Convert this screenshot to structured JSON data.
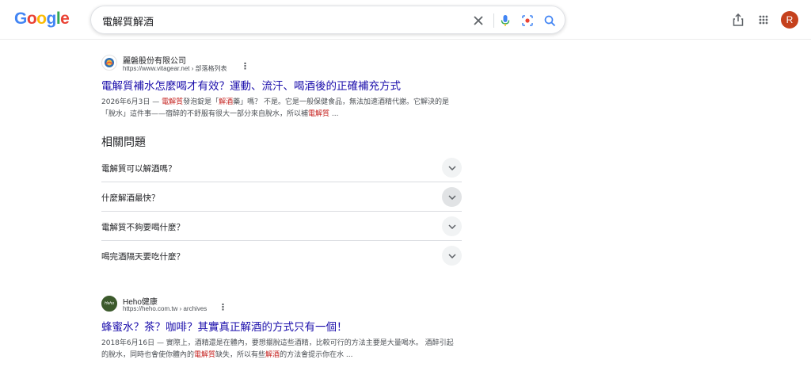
{
  "header": {
    "logo_letters": [
      {
        "ch": "G",
        "color": "#4285f4"
      },
      {
        "ch": "o",
        "color": "#ea4335"
      },
      {
        "ch": "o",
        "color": "#fbbc05"
      },
      {
        "ch": "g",
        "color": "#4285f4"
      },
      {
        "ch": "l",
        "color": "#34a853"
      },
      {
        "ch": "e",
        "color": "#ea4335"
      }
    ],
    "search_query": "電解質解酒",
    "avatar_letter": "R",
    "avatar_color": "#c5411d",
    "icons": [
      "clear-icon",
      "mic-icon",
      "lens-icon",
      "search-icon",
      "share-icon",
      "apps-grid-icon"
    ]
  },
  "results": [
    {
      "site_name": "麗磐股份有限公司",
      "url": "https://www.vitagear.net › 部落格列表",
      "title": "電解質補水怎麼喝才有效？運動、流汗、喝酒後的正確補充方式",
      "snippet_parts": [
        {
          "t": "2026年6月3日 — ",
          "hl": false
        },
        {
          "t": "電解質",
          "hl": true
        },
        {
          "t": "發泡錠是「",
          "hl": false
        },
        {
          "t": "解酒",
          "hl": true
        },
        {
          "t": "藥」嗎？ 不是。它是一般保健食品，無法加速酒精代謝。它解決的是「脫水」這件事——宿醉的不舒服有很大一部分來自脫水，所以補",
          "hl": false
        },
        {
          "t": "電解質",
          "hl": true
        },
        {
          "t": " ...",
          "hl": false
        }
      ]
    },
    {
      "site_name": "Heho健康",
      "favicon_text": "Heho",
      "url": "https://heho.com.tw › archives",
      "title": "蜂蜜水？茶？咖啡？其實真正解酒的方式只有一個！",
      "snippet_parts": [
        {
          "t": "2018年6月16日 — 實際上，酒精還是在體內，要想擺脫這些酒精，比較可行的方法主要是大量喝水。 酒醉引起的脫水，同時也會使你體內的",
          "hl": false
        },
        {
          "t": "電解質",
          "hl": true
        },
        {
          "t": "缺失，所以有些",
          "hl": false
        },
        {
          "t": "解酒",
          "hl": true
        },
        {
          "t": "的方法會提示你在水 ...",
          "hl": false
        }
      ]
    }
  ],
  "related_questions": {
    "title": "相關問題",
    "items": [
      "電解質可以解酒嗎？",
      "什麼解酒最快？",
      "電解質不夠要喝什麼？",
      "喝完酒隔天要吃什麼？"
    ]
  }
}
